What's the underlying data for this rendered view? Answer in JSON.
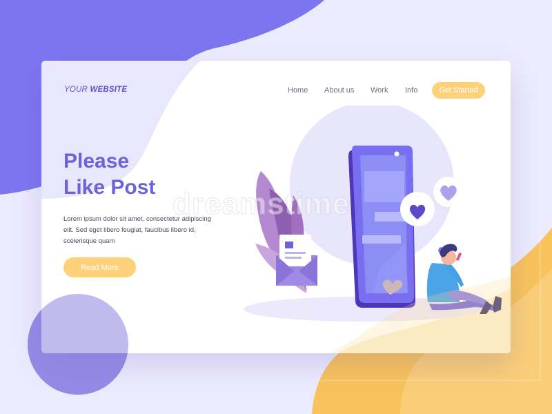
{
  "brand": {
    "prefix": "YOUR",
    "name": "WEBSITE"
  },
  "nav": {
    "items": [
      "Home",
      "About us",
      "Work",
      "Info"
    ],
    "cta_label": "Get Started"
  },
  "hero": {
    "title_line1": "Please",
    "title_line2": "Like Post",
    "body": "Lorem ipsum dolor sit amet, consectetur adipiscing elit. Sed eget libero feugiat, faucibus libero id, scelerisque quam",
    "button_label": "Read More"
  },
  "watermark": "dreamstime",
  "colors": {
    "accent_purple": "#6c63d9",
    "button_yellow": "#fdd17a",
    "background": "#eceafd",
    "blob_purple": "#7d78ee"
  },
  "icons": [
    "heart-icon",
    "envelope-icon",
    "phone-device-icon",
    "person-icon",
    "leaf-plant-icon"
  ]
}
